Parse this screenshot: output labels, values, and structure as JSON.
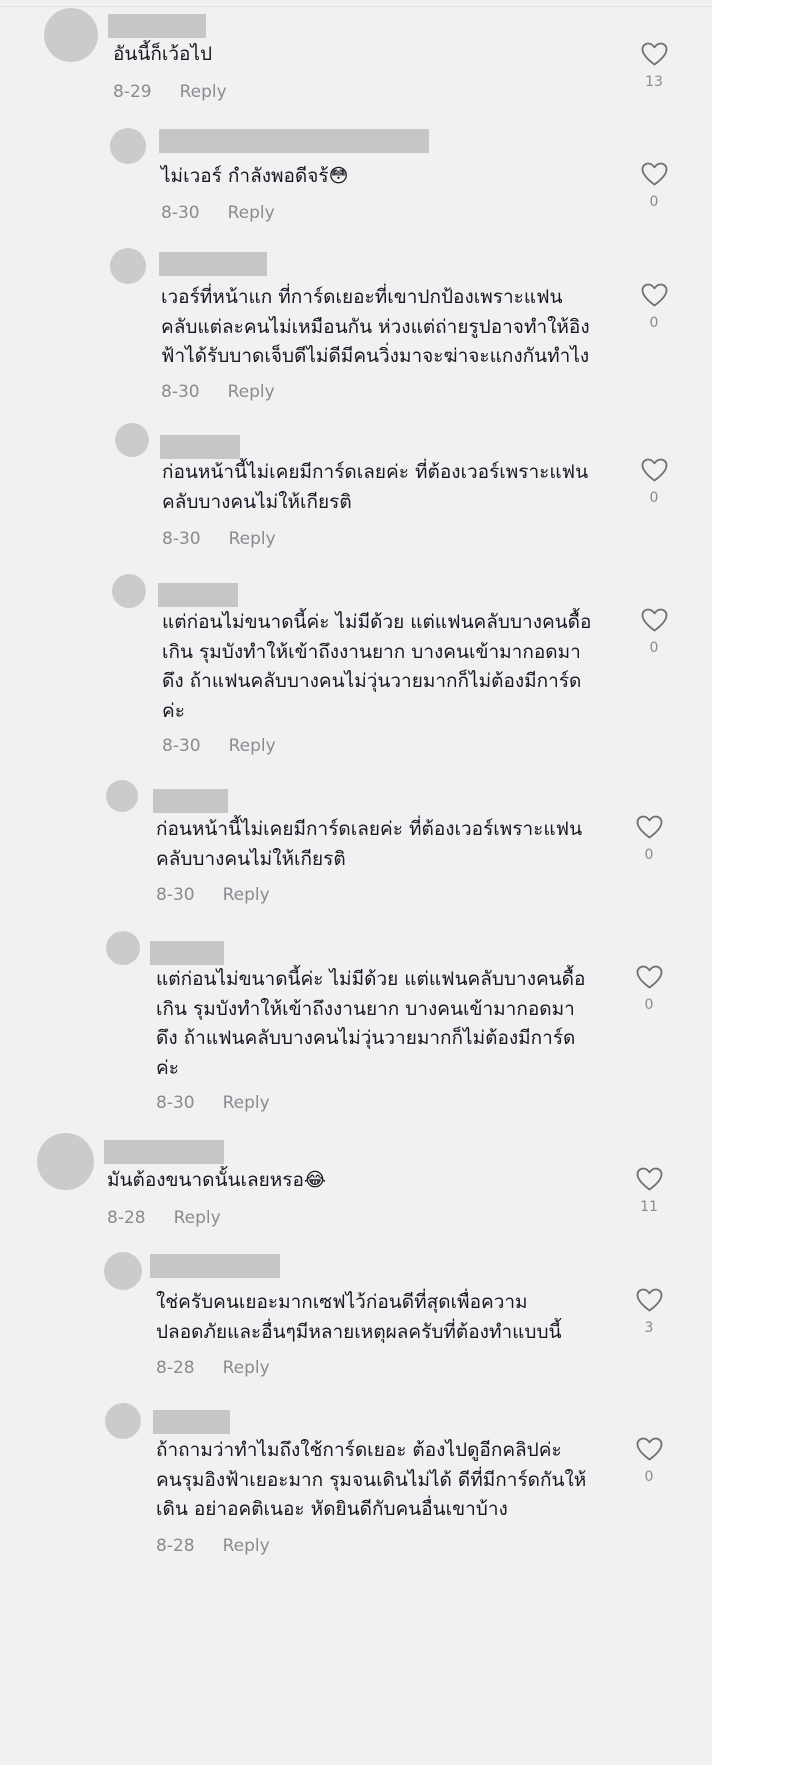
{
  "comments": [
    {
      "level": "top",
      "text": [
        "อันนี้ก็เว้อไป"
      ],
      "emoji": "",
      "date": "8-29",
      "reply_label": "Reply",
      "likes": "13"
    },
    {
      "level": "reply",
      "text": [
        "ไม่เวอร์ กำลังพอดีจร้"
      ],
      "emoji": "😳",
      "date": "8-30",
      "reply_label": "Reply",
      "likes": "0"
    },
    {
      "level": "reply",
      "text": [
        "เวอร์ที่หน้าแก ที่การ์ดเยอะที่เขาปกป้องเพราะแฟน",
        "คลับแต่ละคนไม่เหมือนกัน ห่วงแต่ถ่ายรูปอาจทำให้อิง",
        "ฟ้าได้รับบาดเจ็บดีไม่ดีมีคนวิ่งมาจะฆ่าจะแกงกันทำไง"
      ],
      "emoji": "",
      "date": "8-30",
      "reply_label": "Reply",
      "likes": "0"
    },
    {
      "level": "reply",
      "text": [
        "ก่อนหน้านี้ไม่เคยมีการ์ดเลยค่ะ ที่ต้องเวอร์เพราะแฟน",
        "คลับบางคนไม่ให้เกียรติ"
      ],
      "emoji": "",
      "date": "8-30",
      "reply_label": "Reply",
      "likes": "0"
    },
    {
      "level": "reply",
      "text": [
        "แต่ก่อนไม่ขนาดนี้ค่ะ ไม่มีด้วย แต่แฟนคลับบางคนดื้อ",
        "เกิน รุมบังทำให้เข้าถึงงานยาก บางคนเข้ามากอดมา",
        "ดึง ถ้าแฟนคลับบางคนไม่วุ่นวายมากก็ไม่ต้องมีการ์ด",
        "ค่ะ"
      ],
      "emoji": "",
      "date": "8-30",
      "reply_label": "Reply",
      "likes": "0"
    },
    {
      "level": "reply",
      "text": [
        "ก่อนหน้านี้ไม่เคยมีการ์ดเลยค่ะ ที่ต้องเวอร์เพราะแฟน",
        "คลับบางคนไม่ให้เกียรติ"
      ],
      "emoji": "",
      "date": "8-30",
      "reply_label": "Reply",
      "likes": "0"
    },
    {
      "level": "reply",
      "text": [
        "แต่ก่อนไม่ขนาดนี้ค่ะ ไม่มีด้วย แต่แฟนคลับบางคนดื้อ",
        "เกิน รุมบังทำให้เข้าถึงงานยาก บางคนเข้ามากอดมา",
        "ดึง ถ้าแฟนคลับบางคนไม่วุ่นวายมากก็ไม่ต้องมีการ์ด",
        "ค่ะ"
      ],
      "emoji": "",
      "date": "8-30",
      "reply_label": "Reply",
      "likes": "0"
    },
    {
      "level": "top",
      "text": [
        "มันต้องขนาดนั้นเลยหรอ"
      ],
      "emoji": "😂",
      "date": "8-28",
      "reply_label": "Reply",
      "likes": "11"
    },
    {
      "level": "reply",
      "text": [
        "ใช่ครับคนเยอะมากเซฟไว้ก่อนดีที่สุดเพื่อความ",
        "ปลอดภัยและอื่นๆมีหลายเหตุผลครับที่ต้องทำแบบนี้"
      ],
      "emoji": "",
      "date": "8-28",
      "reply_label": "Reply",
      "likes": "3"
    },
    {
      "level": "reply",
      "text": [
        "ถ้าถามว่าทำไมถึงใช้การ์ดเยอะ ต้องไปดูอีกคลิปค่ะ",
        "คนรุมอิงฟ้าเยอะมาก รุมจนเดินไม่ได้ ดีที่มีการ์ดกันให้",
        "เดิน อย่าอคติเนอะ หัดยินดีกับคนอื่นเขาบ้าง"
      ],
      "emoji": "",
      "date": "8-28",
      "reply_label": "Reply",
      "likes": "0"
    }
  ]
}
